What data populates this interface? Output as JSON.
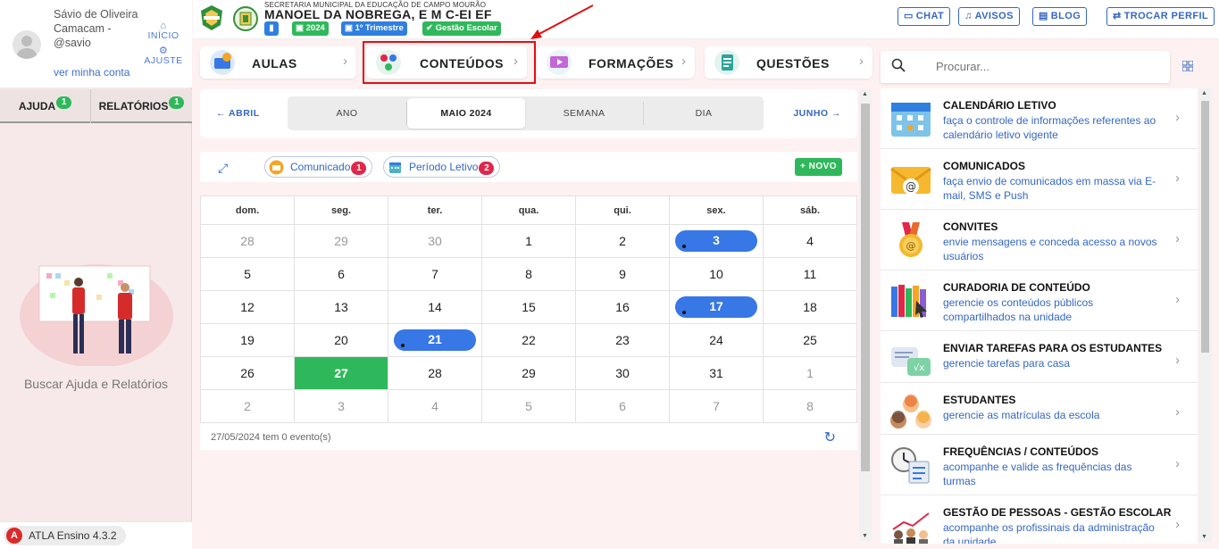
{
  "user": {
    "name": "Sávio de Oliveira Camacam - @savio",
    "account_link": "ver minha conta"
  },
  "side_nav": {
    "home": "INÍCIO",
    "settings": "AJUSTE"
  },
  "side_tabs": {
    "help": "AJUDA",
    "help_count": "1",
    "reports": "RELATÓRIOS",
    "reports_count": "1"
  },
  "help_text": "Buscar Ajuda e Relatórios",
  "version": "ATLA Ensino 4.3.2",
  "header": {
    "secretaria": "SECRETARIA MUNICIPAL DA EDUCAÇÃO DE CAMPO MOURÃO",
    "school": "MANOEL DA NOBREGA, E M C-EI EF",
    "year": "2024",
    "term": "1º Trimestre",
    "mode": "Gestão Escolar",
    "buttons": {
      "chat": "CHAT",
      "notices": "AVISOS",
      "blog": "BLOG",
      "switch_profile": "TROCAR PERFIL"
    }
  },
  "modules": [
    {
      "label": "AULAS"
    },
    {
      "label": "CONTEÚDOS"
    },
    {
      "label": "FORMAÇÕES"
    },
    {
      "label": "QUESTÕES"
    }
  ],
  "calendar": {
    "prev": "ABRIL",
    "next": "JUNHO",
    "views": [
      "ANO",
      "MAIO 2024",
      "SEMANA",
      "DIA"
    ],
    "filters": [
      {
        "label": "Comunicado",
        "count": "1"
      },
      {
        "label": "Período Letivo",
        "count": "2"
      }
    ],
    "new_button": "NOVO",
    "weekdays": [
      "dom.",
      "seg.",
      "ter.",
      "qua.",
      "qui.",
      "sex.",
      "sáb."
    ],
    "weeks": [
      [
        "28",
        "29",
        "30",
        "1",
        "2",
        "3",
        "4"
      ],
      [
        "5",
        "6",
        "7",
        "8",
        "9",
        "10",
        "11"
      ],
      [
        "12",
        "13",
        "14",
        "15",
        "16",
        "17",
        "18"
      ],
      [
        "19",
        "20",
        "21",
        "22",
        "23",
        "24",
        "25"
      ],
      [
        "26",
        "27",
        "28",
        "29",
        "30",
        "31",
        "1"
      ],
      [
        "2",
        "3",
        "4",
        "5",
        "6",
        "7",
        "8"
      ]
    ],
    "summary": "27/05/2024 tem 0 evento(s)"
  },
  "search": {
    "placeholder": "Procurar..."
  },
  "features": [
    {
      "title": "CALENDÁRIO LETIVO",
      "desc": "faça o controle de informações referentes ao calendário letivo vigente"
    },
    {
      "title": "COMUNICADOS",
      "desc": "faça envio de comunicados em massa via E-mail, SMS e Push"
    },
    {
      "title": "CONVITES",
      "desc": "envie mensagens e conceda acesso a novos usuários"
    },
    {
      "title": "CURADORIA DE CONTEÚDO",
      "desc": "gerencie os conteúdos públicos compartilhados na unidade"
    },
    {
      "title": "ENVIAR TAREFAS PARA OS ESTUDANTES",
      "desc": "gerencie tarefas para casa"
    },
    {
      "title": "ESTUDANTES",
      "desc": "gerencie as matrículas da escola"
    },
    {
      "title": "FREQUÊNCIAS / CONTEÚDOS",
      "desc": "acompanhe e valide as frequências das turmas"
    },
    {
      "title": "GESTÃO DE PESSOAS - GESTÃO ESCOLAR",
      "desc": "acompanhe os profissinais da administração da unidade"
    }
  ],
  "colors": {
    "accent": "#3467c4",
    "success": "#2fb85b",
    "danger": "#e0274a",
    "highlight": "#e01010"
  }
}
